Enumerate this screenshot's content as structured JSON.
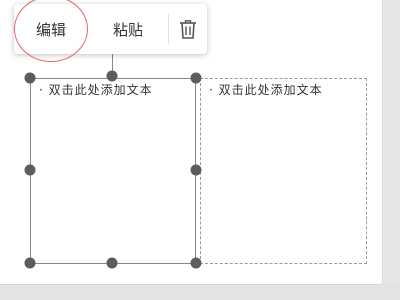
{
  "toolbar": {
    "edit_label": "编辑",
    "paste_label": "粘贴",
    "delete_icon": "trash-icon"
  },
  "text_boxes": [
    {
      "bullet": "·",
      "placeholder": "双击此处添加文本",
      "selected": true
    },
    {
      "bullet": "·",
      "placeholder": "双击此处添加文本",
      "selected": false
    }
  ],
  "colors": {
    "highlight_circle": "#e06a6a",
    "handle": "#5d5d5d"
  }
}
